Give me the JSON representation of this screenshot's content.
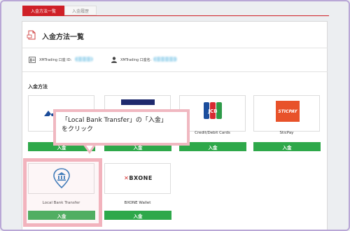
{
  "tabs": {
    "deposit_methods": "入金方法一覧",
    "deposit_history": "入金履歴"
  },
  "page": {
    "title": "入金方法一覧"
  },
  "account": {
    "id_label": "XMTrading 口座 ID:",
    "name_label": "XMTrading 口座名:"
  },
  "section": {
    "title": "入金方法"
  },
  "methods": [
    {
      "name": "",
      "button": "入金"
    },
    {
      "name": "",
      "button": "入金"
    },
    {
      "name": "Credit/Debit Cards",
      "button": "入金"
    },
    {
      "name": "SticPay",
      "button": "入金"
    },
    {
      "name": "Local Bank Transfer",
      "button": "入金"
    },
    {
      "name": "BXONE Wallet",
      "button": "入金"
    }
  ],
  "logos": {
    "jcb": "JCB",
    "sticpay": "STICPAY",
    "bxone": "BXONE"
  },
  "callout": {
    "line1": "「Local Bank Transfer」の「入金」",
    "line2": "をクリック"
  },
  "colors": {
    "accent_red": "#cf2027",
    "button_green": "#2ea84a",
    "highlight_pink": "#f2b3bd",
    "frame_lavender": "#b9a7d6"
  }
}
